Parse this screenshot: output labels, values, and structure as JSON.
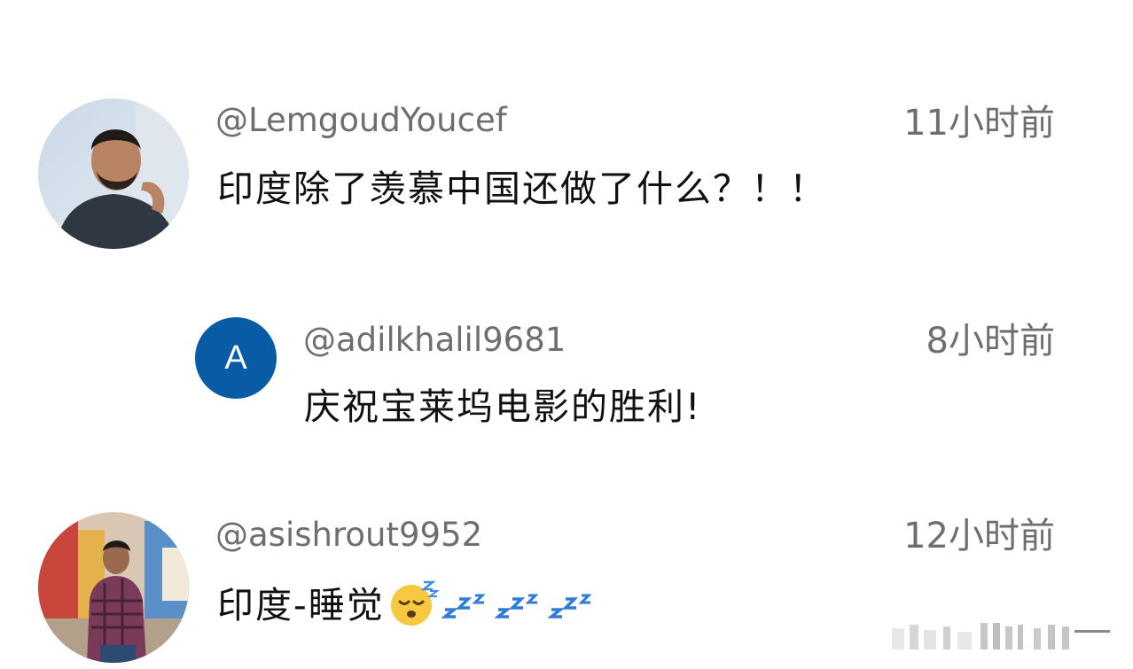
{
  "comments": [
    {
      "username": "@LemgoudYoucef",
      "time": "11小时前",
      "text": "印度除了羡慕中国还做了什么？！！",
      "avatar": "photo-man-dark-shirt"
    },
    {
      "username": "@adilkhalil9681",
      "time": "8小时前",
      "text": "庆祝宝莱坞电影的胜利!",
      "avatar_letter": "A",
      "avatar_color": "#0a5ba6"
    },
    {
      "username": "@asishrout9952",
      "time": "12小时前",
      "text": "印度-睡觉",
      "avatar": "photo-man-plaid-shirt",
      "emoji": "sleeping-face",
      "trailing_icons": [
        "zzz-icon",
        "zzz-icon",
        "zzz-icon"
      ]
    }
  ]
}
